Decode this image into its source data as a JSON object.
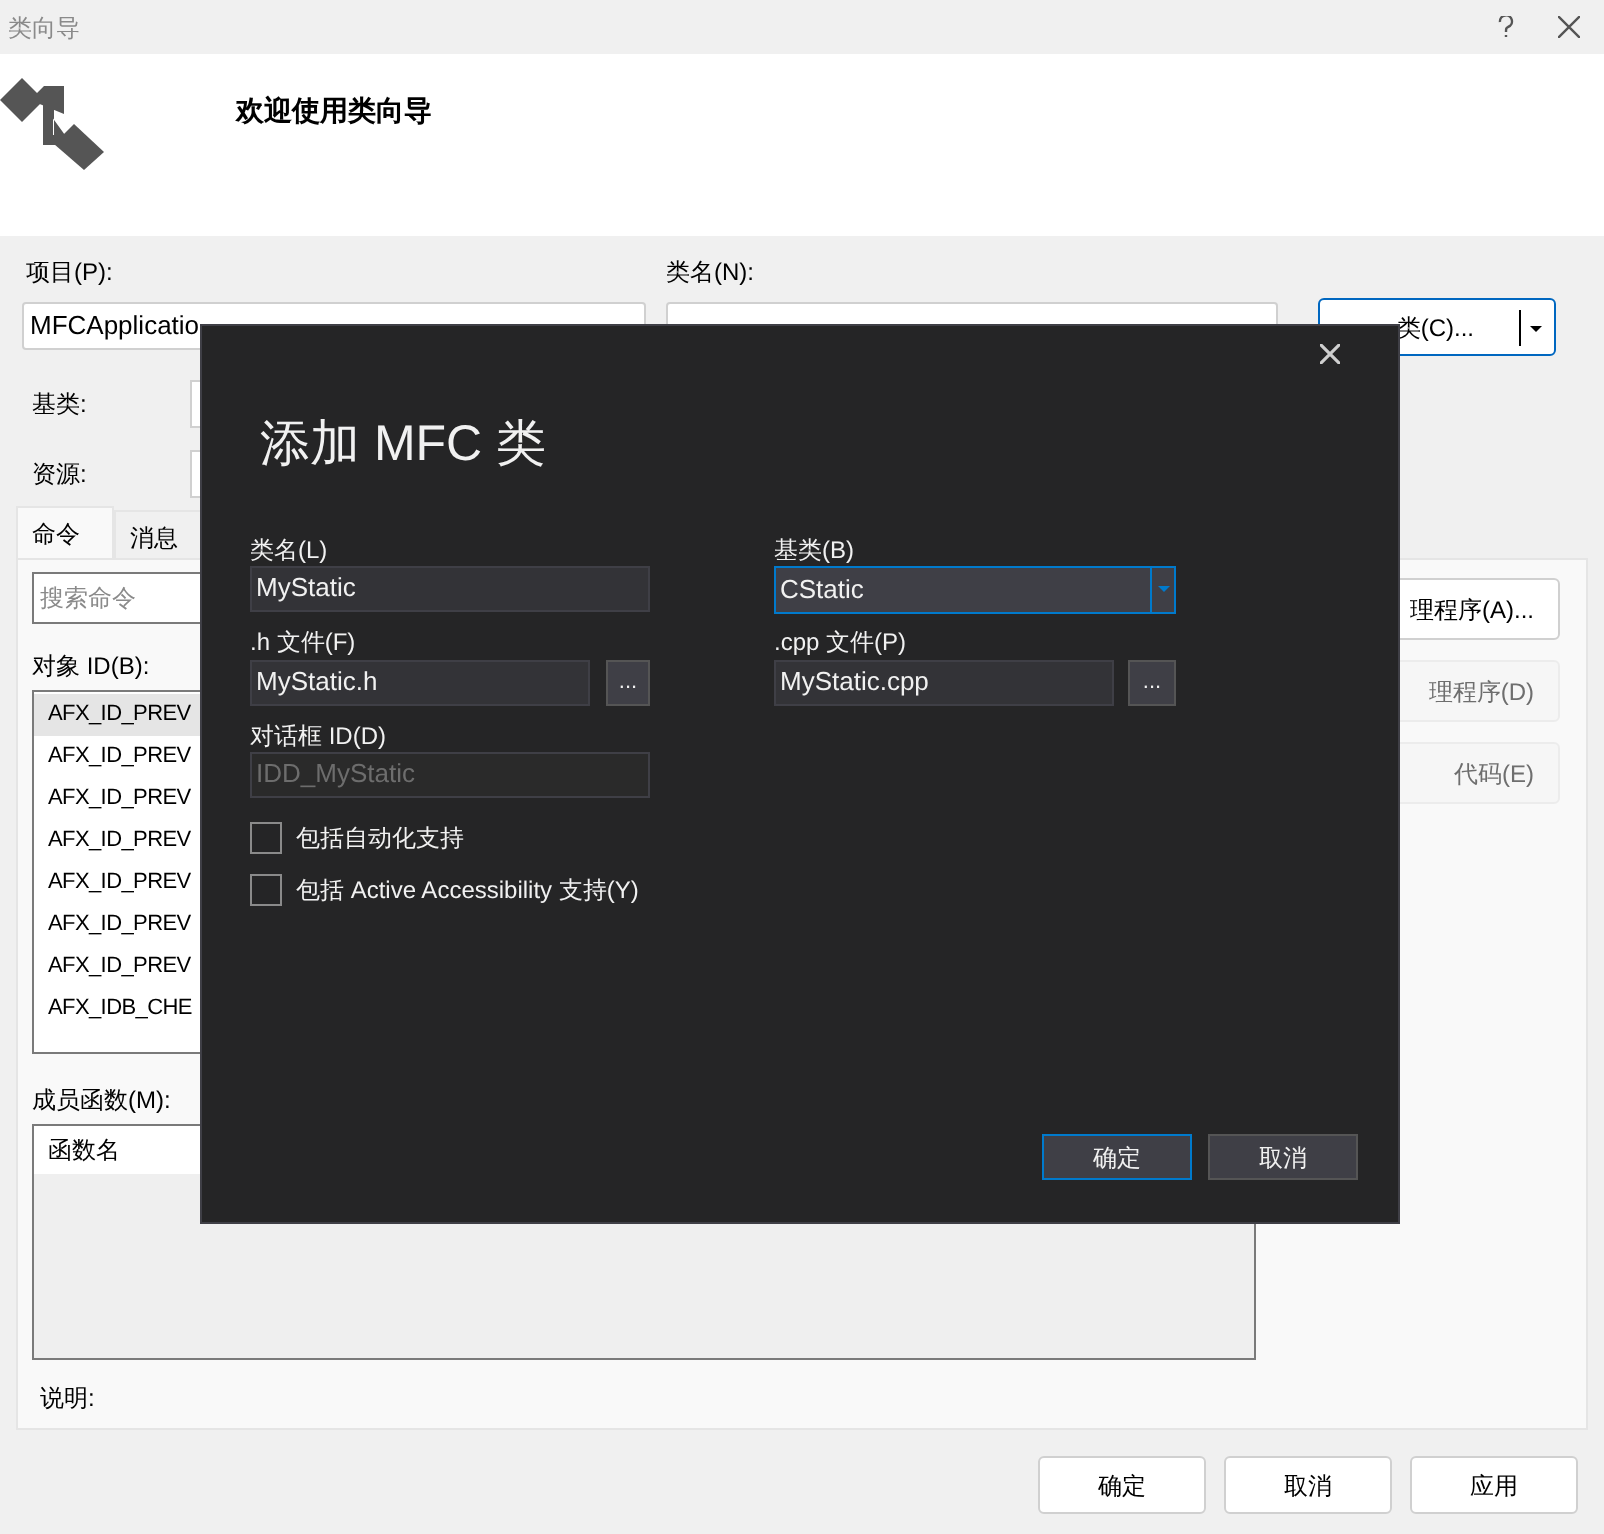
{
  "window": {
    "title": "类向导"
  },
  "header": {
    "title": "欢迎使用类向导"
  },
  "project": {
    "label": "项目(P):",
    "value": "MFCApplicatio"
  },
  "class_name": {
    "label": "类名(N):"
  },
  "add_class_button": {
    "label": "类(C)..."
  },
  "base_class": {
    "label": "基类:"
  },
  "resource": {
    "label": "资源:"
  },
  "tabs": [
    {
      "label": "命令",
      "selected": true
    },
    {
      "label": "消息",
      "selected": false
    }
  ],
  "search": {
    "placeholder": "搜索命令"
  },
  "object_ids": {
    "label": "对象 ID(B):",
    "items": [
      {
        "text": "AFX_ID_PREV",
        "selected": true
      },
      {
        "text": "AFX_ID_PREV",
        "selected": false
      },
      {
        "text": "AFX_ID_PREV",
        "selected": false
      },
      {
        "text": "AFX_ID_PREV",
        "selected": false
      },
      {
        "text": "AFX_ID_PREV",
        "selected": false
      },
      {
        "text": "AFX_ID_PREV",
        "selected": false
      },
      {
        "text": "AFX_ID_PREV",
        "selected": false
      },
      {
        "text": "AFX_IDB_CHE",
        "selected": false
      }
    ]
  },
  "handler_buttons": [
    {
      "label": "理程序(A)...",
      "disabled": false
    },
    {
      "label": "理程序(D)",
      "disabled": true
    },
    {
      "label": "代码(E)",
      "disabled": true
    }
  ],
  "member_functions": {
    "label": "成员函数(M):",
    "column": "函数名"
  },
  "description": {
    "label": "说明:"
  },
  "footer_buttons": [
    "确定",
    "取消",
    "应用"
  ],
  "dialog": {
    "title": "添加 MFC 类",
    "class_name": {
      "label": "类名(L)",
      "value": "MyStatic"
    },
    "h_file": {
      "label": ".h 文件(F)",
      "value": "MyStatic.h",
      "browse": "..."
    },
    "dialog_id": {
      "label": "对话框 ID(D)",
      "value": "IDD_MyStatic",
      "disabled": true
    },
    "base_class": {
      "label": "基类(B)",
      "value": "CStatic"
    },
    "cpp_file": {
      "label": ".cpp 文件(P)",
      "value": "MyStatic.cpp",
      "browse": "..."
    },
    "checkboxes": [
      {
        "label": "包括自动化支持",
        "checked": false
      },
      {
        "label": "包括 Active Accessibility 支持(Y)",
        "checked": false
      }
    ],
    "buttons": [
      {
        "label": "确定",
        "default": true
      },
      {
        "label": "取消",
        "default": false
      }
    ]
  }
}
